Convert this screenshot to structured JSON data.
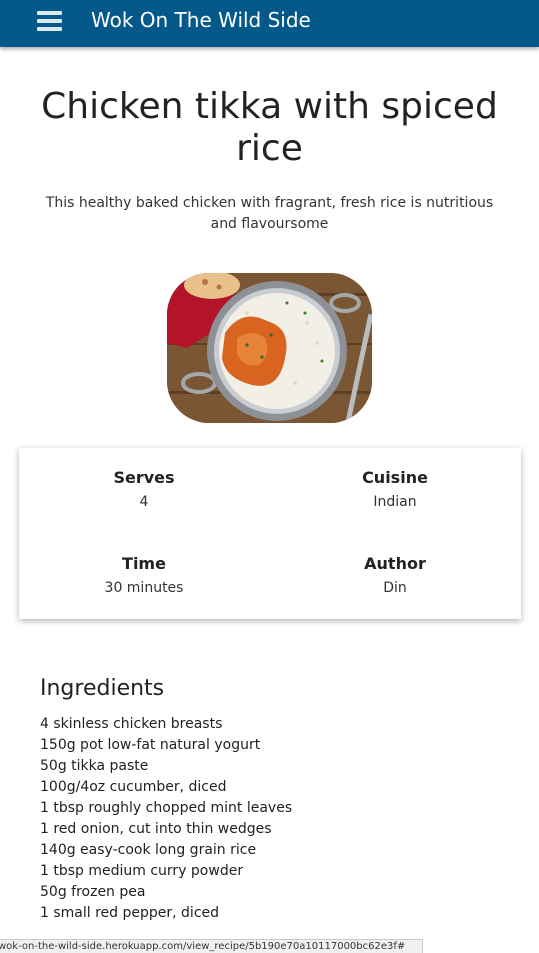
{
  "navbar": {
    "brand": "Wok On The Wild Side",
    "menu_icon": "hamburger-menu-icon"
  },
  "recipe": {
    "title": "Chicken tikka with spiced rice",
    "description": "This healthy baked chicken with fragrant, fresh rice is nutritious and flavoursome",
    "image_icon": "recipe-photo"
  },
  "info": {
    "serves_label": "Serves",
    "serves_value": "4",
    "cuisine_label": "Cuisine",
    "cuisine_value": "Indian",
    "time_label": "Time",
    "time_value": "30 minutes",
    "author_label": "Author",
    "author_value": "Din"
  },
  "ingredients": {
    "heading": "Ingredients",
    "items": [
      "4 skinless chicken breasts",
      "150g pot low-fat natural yogurt",
      "50g tikka paste",
      "100g/4oz cucumber, diced",
      "1 tbsp roughly chopped mint leaves",
      "1 red onion, cut into thin wedges",
      "140g easy-cook long grain rice",
      "1 tbsp medium curry powder",
      "50g frozen pea",
      "1 small red pepper, diced"
    ]
  },
  "status_bar": {
    "url": "wok-on-the-wild-side.herokuapp.com/view_recipe/5b190e70a10117000bc62e3f#"
  },
  "colors": {
    "navbar": "#04588a",
    "text": "#222222"
  }
}
